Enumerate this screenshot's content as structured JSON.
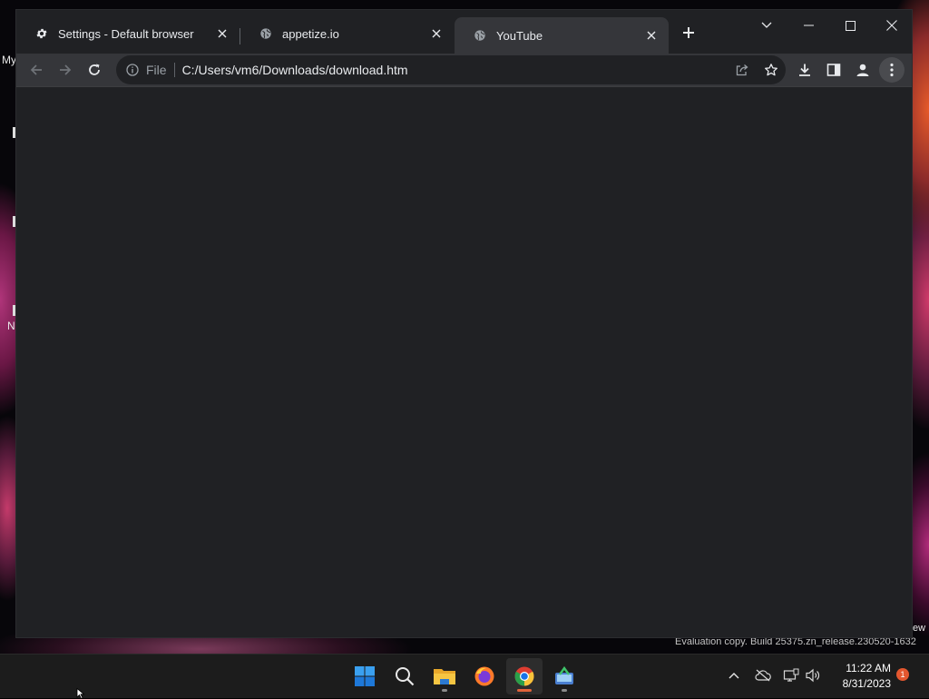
{
  "desktop": {
    "label_top": "My",
    "label_mid": "N",
    "label_right": "ew",
    "watermark": "Evaluation copy. Build 25375.zn_release.230520-1632"
  },
  "browser": {
    "tabs": [
      {
        "title": "Settings - Default browser",
        "icon": "gear-icon",
        "active": false
      },
      {
        "title": "appetize.io",
        "icon": "globe-icon",
        "active": false
      },
      {
        "title": "YouTube",
        "icon": "globe-icon",
        "active": true
      }
    ],
    "omnibox": {
      "scheme": "File",
      "url": "C:/Users/vm6/Downloads/download.htm"
    }
  },
  "taskbar": {
    "apps": [
      "start-icon",
      "search-icon",
      "file-explorer-icon",
      "firefox-icon",
      "chrome-icon",
      "app-icon"
    ],
    "clock": {
      "time": "11:22 AM",
      "date": "8/31/2023"
    },
    "notification_count": "1"
  },
  "colors": {
    "window_bg": "#202124",
    "toolbar_bg": "#35363a",
    "text": "#e8eaed",
    "taskbar_bg": "#1c1c1c"
  }
}
